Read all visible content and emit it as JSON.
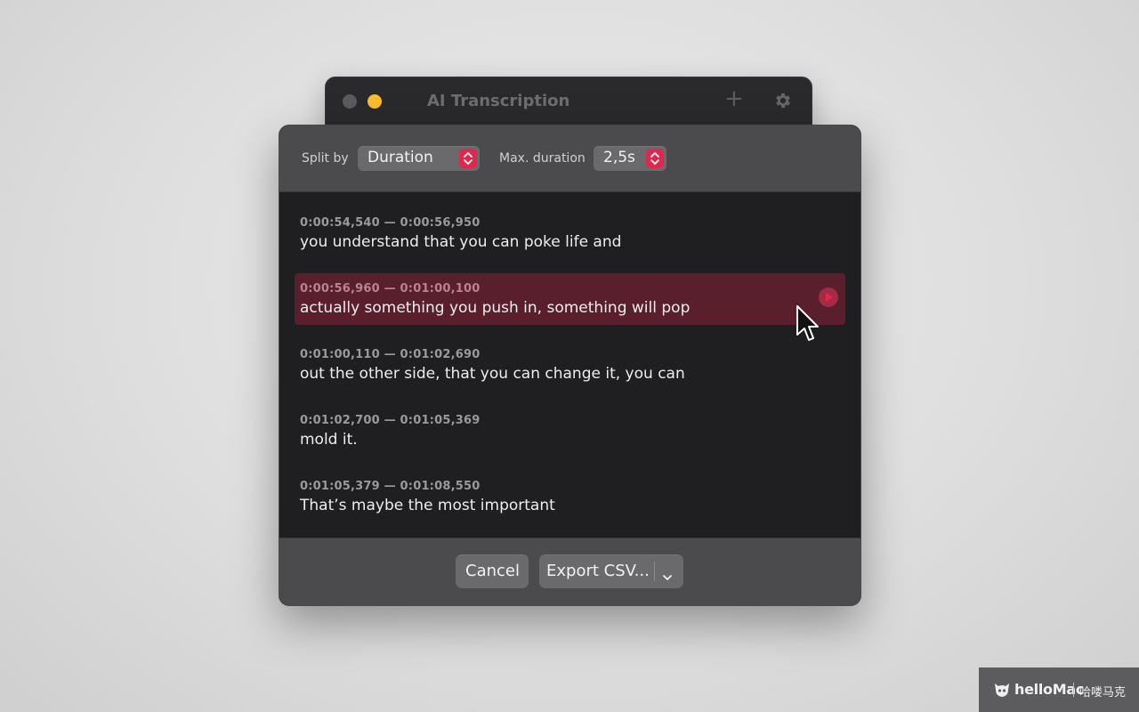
{
  "back_window": {
    "title": "AI Transcription",
    "add_icon": "plus-icon",
    "settings_icon": "gear-icon"
  },
  "toolbar": {
    "split_by_label": "Split by",
    "split_by_value": "Duration",
    "max_duration_label": "Max. duration",
    "max_duration_value": "2,5s"
  },
  "segments": [
    {
      "time": "0:00:54,540 — 0:00:56,950",
      "text": "you understand that you can poke life and",
      "active": false
    },
    {
      "time": "0:00:56,960 — 0:01:00,100",
      "text": "actually something you push in, something will pop",
      "active": true
    },
    {
      "time": "0:01:00,110 — 0:01:02,690",
      "text": "out the other side, that you can change it, you can",
      "active": false
    },
    {
      "time": "0:01:02,700 — 0:01:05,369",
      "text": "mold it.",
      "active": false
    },
    {
      "time": "0:01:05,379 — 0:01:08,550",
      "text": "That’s maybe the most important",
      "active": false
    }
  ],
  "footer": {
    "cancel_label": "Cancel",
    "export_label": "Export CSV..."
  },
  "watermark": {
    "brand": "helloMac",
    "cn": "哈喽马克"
  },
  "colors": {
    "accent": "#e0284f",
    "highlight_row": "#5a1f2c"
  }
}
